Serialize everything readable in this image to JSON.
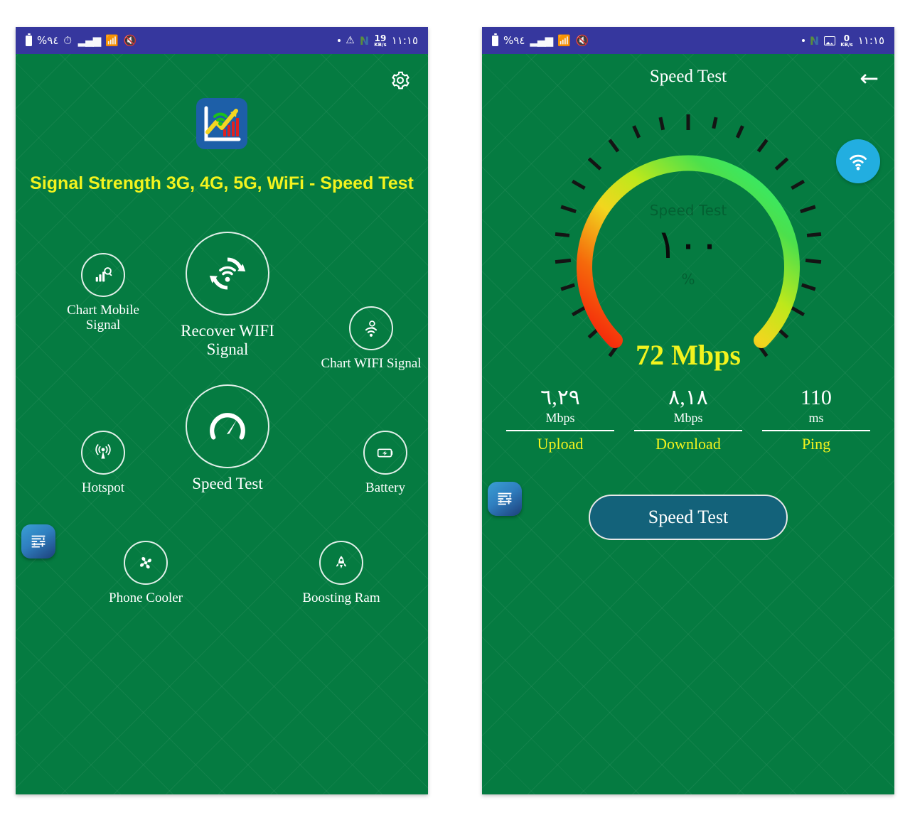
{
  "status_bar": {
    "battery_pct": "%٩٤",
    "time": "١١:١٥",
    "left_icons": [
      "battery-icon",
      "signal-bars-icon",
      "wifi-icon",
      "mute-icon"
    ],
    "right_icons_left_phone": [
      "dot-icon",
      "warning-icon",
      "n-logo-icon"
    ],
    "right_icons_right_phone": [
      "dot-icon",
      "n-logo-icon",
      "image-icon"
    ],
    "net_rate_left": "19",
    "net_rate_right": "0",
    "net_rate_unit": "KB/s",
    "bar_color": "#36379E"
  },
  "left_screen": {
    "gear_icon": "gear-icon",
    "app_logo_icon": "app-logo-icon",
    "app_title": "Signal Strength 3G, 4G, 5G, WiFi - Speed Test",
    "title_color": "#F2F31E",
    "badge_icon": "kufic-badge-icon",
    "tiles": [
      {
        "id": "chart-mobile-signal",
        "label": "Chart Mobile\nSignal",
        "icon": "signal-chart-search-icon",
        "size": "small"
      },
      {
        "id": "recover-wifi-signal",
        "label": "Recover WIFI\nSignal",
        "icon": "refresh-wifi-icon",
        "size": "big"
      },
      {
        "id": "chart-wifi-signal",
        "label": "Chart WIFI Signal",
        "icon": "wifi-search-icon",
        "size": "small"
      },
      {
        "id": "hotspot",
        "label": "Hotspot",
        "icon": "hotspot-antenna-icon",
        "size": "small"
      },
      {
        "id": "speed-test",
        "label": "Speed Test",
        "icon": "speedometer-icon",
        "size": "big"
      },
      {
        "id": "battery",
        "label": "Battery",
        "icon": "battery-charging-icon",
        "size": "small"
      },
      {
        "id": "phone-cooler",
        "label": "Phone Cooler",
        "icon": "fan-icon",
        "size": "small"
      },
      {
        "id": "boosting-ram",
        "label": "Boosting Ram",
        "icon": "rocket-icon",
        "size": "small"
      }
    ]
  },
  "right_screen": {
    "title": "Speed Test",
    "back_icon": "back-arrow-icon",
    "fab_icon": "wifi-icon",
    "fab_color": "#22AEE0",
    "badge_icon": "kufic-badge-icon",
    "gauge": {
      "center_label": "Speed Test",
      "center_value": "١٠٠",
      "center_unit": "%",
      "progress_pct": 100,
      "color_start": "#F51B0B",
      "color_mid": "#F2F31E",
      "color_end": "#23F27E"
    },
    "result": "72 Mbps",
    "result_color": "#F2F31E",
    "stats": [
      {
        "value": "٦,٢٩",
        "unit": "Mbps",
        "name": "Upload"
      },
      {
        "value": "٨,١٨",
        "unit": "Mbps",
        "name": "Download"
      },
      {
        "value": "110",
        "unit": "ms",
        "name": "Ping"
      }
    ],
    "button_label": "Speed Test",
    "button_color": "#13627A"
  },
  "theme": {
    "screen_green": "#057B41",
    "accent_yellow": "#F2F31E",
    "status_blue": "#36379E"
  }
}
